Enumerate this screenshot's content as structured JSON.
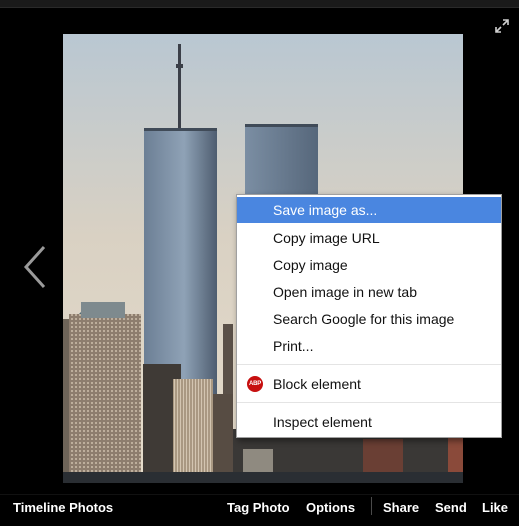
{
  "viewer": {
    "expand_icon": "expand-icon",
    "prev_icon": "chevron-left-icon"
  },
  "caption": {
    "album_title": "Timeline Photos",
    "actions": {
      "tag_photo": "Tag Photo",
      "options": "Options",
      "share": "Share",
      "send": "Send",
      "like": "Like"
    }
  },
  "context_menu": {
    "highlight_color": "#4a86e0",
    "items": [
      {
        "label": "Save image as..."
      },
      {
        "label": "Copy image URL"
      },
      {
        "label": "Copy image"
      },
      {
        "label": "Open image in new tab"
      },
      {
        "label": "Search Google for this image"
      },
      {
        "label": "Print..."
      },
      {
        "label": "Block element",
        "icon": "adblock-plus-icon",
        "icon_text": "ABP"
      },
      {
        "label": "Inspect element"
      }
    ]
  }
}
